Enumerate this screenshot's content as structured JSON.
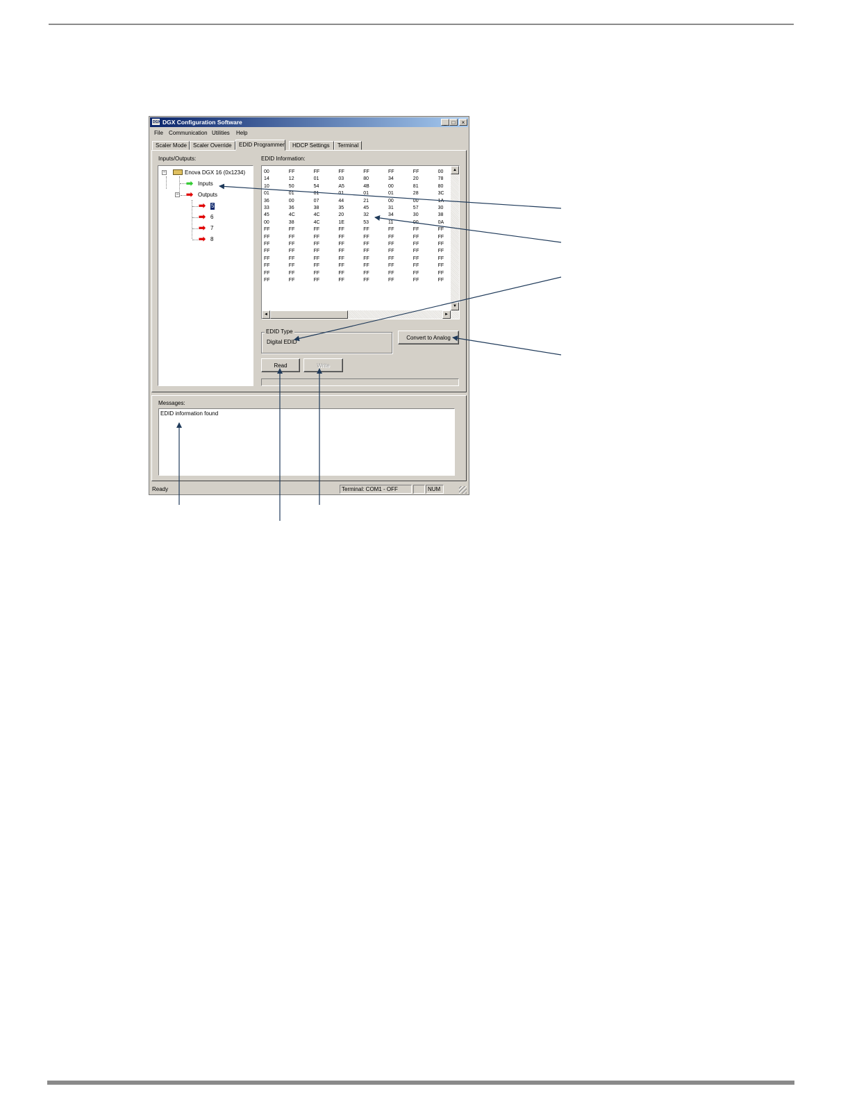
{
  "window": {
    "title": "DGX Configuration Software",
    "app_icon_label": "DGX"
  },
  "menu": [
    "File",
    "Communication",
    "Utilities",
    "Help"
  ],
  "tabs": [
    {
      "label": "Scaler Mode",
      "active": false
    },
    {
      "label": "Scaler Override",
      "active": false
    },
    {
      "label": "EDID Programmer",
      "active": true
    },
    {
      "label": "HDCP Settings",
      "active": false
    },
    {
      "label": "Terminal",
      "active": false
    }
  ],
  "io_panel": {
    "label": "Inputs/Outputs:",
    "device": "Enova DGX 16 (0x1234)",
    "inputs_label": "Inputs",
    "outputs_label": "Outputs",
    "outputs": [
      "5",
      "6",
      "7",
      "8"
    ],
    "selected_output": "5"
  },
  "edid": {
    "label": "EDID Information:",
    "rows": [
      [
        "00",
        "FF",
        "FF",
        "FF",
        "FF",
        "FF",
        "FF",
        "00"
      ],
      [
        "14",
        "12",
        "01",
        "03",
        "80",
        "34",
        "20",
        "78"
      ],
      [
        "10",
        "50",
        "54",
        "A5",
        "4B",
        "00",
        "81",
        "80"
      ],
      [
        "01",
        "01",
        "01",
        "01",
        "01",
        "01",
        "28",
        "3C"
      ],
      [
        "36",
        "00",
        "07",
        "44",
        "21",
        "00",
        "00",
        "1A"
      ],
      [
        "33",
        "36",
        "38",
        "35",
        "45",
        "31",
        "57",
        "30"
      ],
      [
        "45",
        "4C",
        "4C",
        "20",
        "32",
        "34",
        "30",
        "38"
      ],
      [
        "00",
        "38",
        "4C",
        "1E",
        "53",
        "11",
        "00",
        "0A"
      ],
      [
        "FF",
        "FF",
        "FF",
        "FF",
        "FF",
        "FF",
        "FF",
        "FF"
      ],
      [
        "FF",
        "FF",
        "FF",
        "FF",
        "FF",
        "FF",
        "FF",
        "FF"
      ],
      [
        "FF",
        "FF",
        "FF",
        "FF",
        "FF",
        "FF",
        "FF",
        "FF"
      ],
      [
        "FF",
        "FF",
        "FF",
        "FF",
        "FF",
        "FF",
        "FF",
        "FF"
      ],
      [
        "FF",
        "FF",
        "FF",
        "FF",
        "FF",
        "FF",
        "FF",
        "FF"
      ],
      [
        "FF",
        "FF",
        "FF",
        "FF",
        "FF",
        "FF",
        "FF",
        "FF"
      ],
      [
        "FF",
        "FF",
        "FF",
        "FF",
        "FF",
        "FF",
        "FF",
        "FF"
      ],
      [
        "FF",
        "FF",
        "FF",
        "FF",
        "FF",
        "FF",
        "FF",
        "FF"
      ]
    ]
  },
  "edid_type": {
    "legend": "EDID Type",
    "value": "Digital EDID"
  },
  "buttons": {
    "convert": "Convert to Analog",
    "read": "Read",
    "write": "Write"
  },
  "messages": {
    "label": "Messages:",
    "text": "EDID information found"
  },
  "status": {
    "ready": "Ready",
    "terminal": "Terminal: COM1 - OFF",
    "num": "NUM"
  },
  "colors": {
    "titlebar_start": "#0a246a",
    "titlebar_end": "#a6caf0",
    "window_face": "#d4d0c8",
    "input_arrow": "#33cc33",
    "output_arrow": "#e00000",
    "callout": "#1f3a5a"
  }
}
